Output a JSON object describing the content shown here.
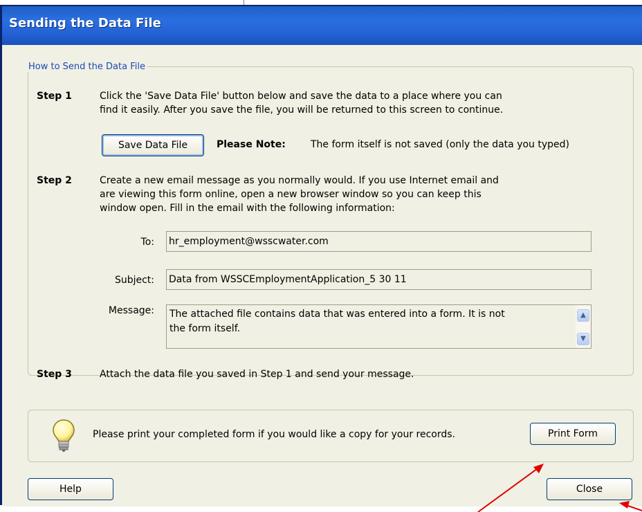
{
  "dialog": {
    "title": "Sending the Data File"
  },
  "howto": {
    "legend": "How to Send the Data File",
    "step1": {
      "label": "Step 1",
      "line1": "Click the 'Save Data File' button below and save the data to a place where you can",
      "line2": "find it easily. After you save the file, you will be returned to this screen to continue.",
      "save_button": "Save Data File",
      "note_label": "Please Note:",
      "note_text": "The form itself is not saved (only the data you typed)"
    },
    "step2": {
      "label": "Step 2",
      "line1": "Create a new email message as you normally would.  If you use Internet email and",
      "line2": "are viewing this form online, open a new browser window so you can keep this",
      "line3": "window open. Fill in the email with the following information:",
      "to_label": "To:",
      "to_value": "hr_employment@wsscwater.com",
      "subject_label": "Subject:",
      "subject_value": "Data from WSSCEmploymentApplication_5 30 11",
      "message_label": "Message:",
      "message_line1": "The attached file contains data that was entered into a form. It is not",
      "message_line2": "the form itself."
    },
    "step3": {
      "label": "Step 3",
      "text": "Attach the data file you saved in Step 1 and send your message."
    }
  },
  "tip": {
    "icon": "lightbulb-icon",
    "text": "Please print your completed form if you would like a copy for your records.",
    "print_button": "Print Form"
  },
  "footer": {
    "help_button": "Help",
    "close_button": "Close"
  },
  "colors": {
    "title_bar": "#2462d4",
    "legend_text": "#1d49b5",
    "annotation_arrow": "#e00000"
  }
}
